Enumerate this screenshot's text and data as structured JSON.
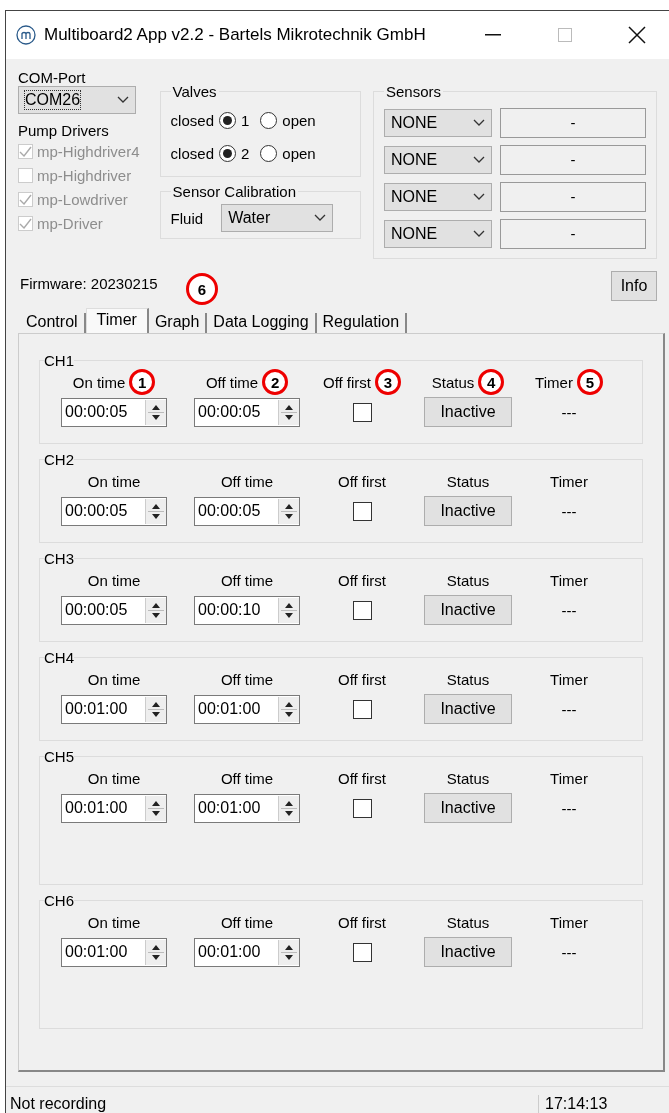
{
  "window": {
    "title": "Multiboard2 App v2.2 - Bartels Mikrotechnik GmbH"
  },
  "com_port": {
    "label": "COM-Port",
    "value": "COM26"
  },
  "pump_drivers": {
    "label": "Pump Drivers",
    "items": [
      {
        "label": "mp-Highdriver4",
        "checked": true
      },
      {
        "label": "mp-Highdriver",
        "checked": false
      },
      {
        "label": "mp-Lowdriver",
        "checked": true
      },
      {
        "label": "mp-Driver",
        "checked": true
      }
    ]
  },
  "valves": {
    "title": "Valves",
    "items": [
      {
        "closed_label": "closed",
        "number": "1",
        "open_label": "open",
        "closed_selected": true,
        "open_selected": false
      },
      {
        "closed_label": "closed",
        "number": "2",
        "open_label": "open",
        "closed_selected": true,
        "open_selected": false
      }
    ]
  },
  "sensor_calibration": {
    "title": "Sensor Calibration",
    "label": "Fluid",
    "value": "Water"
  },
  "sensors": {
    "title": "Sensors",
    "items": [
      {
        "type": "NONE",
        "reading": "-"
      },
      {
        "type": "NONE",
        "reading": "-"
      },
      {
        "type": "NONE",
        "reading": "-"
      },
      {
        "type": "NONE",
        "reading": "-"
      }
    ]
  },
  "firmware": "Firmware: 20230215",
  "info_button": "Info",
  "tabs": [
    {
      "label": "Control",
      "selected": false
    },
    {
      "label": "Timer",
      "selected": true
    },
    {
      "label": "Graph",
      "selected": false
    },
    {
      "label": "Data Logging",
      "selected": false
    },
    {
      "label": "Regulation",
      "selected": false
    }
  ],
  "channels": [
    {
      "name": "CH1",
      "columns": [
        "On time",
        "Off time",
        "Off first",
        "Status",
        "Timer"
      ],
      "on_time": "00:00:05",
      "off_time": "00:00:05",
      "off_first": false,
      "status": "Inactive",
      "timer": "---"
    },
    {
      "name": "CH2",
      "columns": [
        "On time",
        "Off time",
        "Off first",
        "Status",
        "Timer"
      ],
      "on_time": "00:00:05",
      "off_time": "00:00:05",
      "off_first": false,
      "status": "Inactive",
      "timer": "---"
    },
    {
      "name": "CH3",
      "columns": [
        "On time",
        "Off time",
        "Off first",
        "Status",
        "Timer"
      ],
      "on_time": "00:00:05",
      "off_time": "00:00:10",
      "off_first": false,
      "status": "Inactive",
      "timer": "---"
    },
    {
      "name": "CH4",
      "columns": [
        "On time",
        "Off time",
        "Off first",
        "Status",
        "Timer"
      ],
      "on_time": "00:01:00",
      "off_time": "00:01:00",
      "off_first": false,
      "status": "Inactive",
      "timer": "---"
    },
    {
      "name": "CH5",
      "columns": [
        "On time",
        "Off time",
        "Off first",
        "Status",
        "Timer"
      ],
      "on_time": "00:01:00",
      "off_time": "00:01:00",
      "off_first": false,
      "status": "Inactive",
      "timer": "---"
    },
    {
      "name": "CH6",
      "columns": [
        "On time",
        "Off time",
        "Off first",
        "Status",
        "Timer"
      ],
      "on_time": "00:01:00",
      "off_time": "00:01:00",
      "off_first": false,
      "status": "Inactive",
      "timer": "---"
    }
  ],
  "callouts": [
    "1",
    "2",
    "3",
    "4",
    "5",
    "6"
  ],
  "status_bar": {
    "message": "Not recording",
    "time": "17:14:13"
  }
}
